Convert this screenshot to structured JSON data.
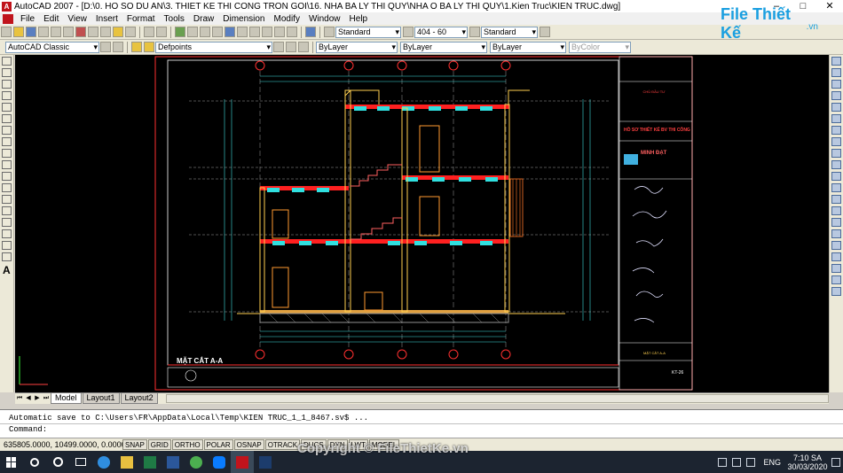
{
  "window": {
    "title": "AutoCAD 2007 - [D:\\0. HO SO DU AN\\3. THIET KE THI CONG TRON GOI\\16. NHA BA LY THI QUY\\NHA O BA LY THI QUY\\1.Kien Truc\\KIEN TRUC.dwg]",
    "minimize": "–",
    "restore": "□",
    "close": "✕"
  },
  "menu": [
    "File",
    "Edit",
    "View",
    "Insert",
    "Format",
    "Tools",
    "Draw",
    "Dimension",
    "Modify",
    "Window",
    "Help"
  ],
  "logo": {
    "main": "File Thiết Kế",
    "suffix": ".vn"
  },
  "toolbar1": {
    "text_style": "Standard",
    "dim_style": "404 - 60",
    "table_style": "Standard"
  },
  "toolbar2": {
    "workspace": "AutoCAD Classic",
    "layer": "Defpoints",
    "color": "ByLayer",
    "linetype": "ByLayer",
    "lineweight": "ByLayer",
    "plotstyle": "ByColor"
  },
  "drawing": {
    "section_title": "MẶT CẮT A-A",
    "grid_labels": [
      "1",
      "2",
      "3",
      "4",
      "5"
    ],
    "titleblock": {
      "project_header": "CHỦ ĐẦU TƯ",
      "stage": "HỒ SƠ THIẾT KẾ BV THI CÔNG",
      "company": "MINH ĐẠT",
      "sheet_name": "MẶT CẮT A-A",
      "sheet_no": "KT-26"
    }
  },
  "layout_tabs": [
    "Model",
    "Layout1",
    "Layout2"
  ],
  "command": {
    "line1": "Automatic save to C:\\Users\\FR\\AppData\\Local\\Temp\\KIEN TRUC_1_1_8467.sv$ ...",
    "line2": "Command:"
  },
  "status": {
    "coords": "635805.0000, 10499.0000, 0.0000",
    "buttons": [
      "SNAP",
      "GRID",
      "ORTHO",
      "POLAR",
      "OSNAP",
      "OTRACK",
      "DUCS",
      "DYN",
      "LWT",
      "MODEL"
    ]
  },
  "taskbar": {
    "lang": "ENG",
    "time": "7:10 SA",
    "date": "30/03/2020"
  },
  "watermark": "Copyright © FileThietKe.vn"
}
